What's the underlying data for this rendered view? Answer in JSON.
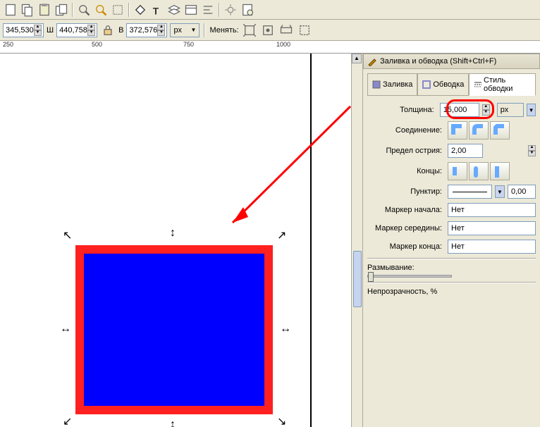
{
  "toolbar2": {
    "coord_value": "345,530",
    "w_label": "Ш",
    "w_value": "440,758",
    "h_label": "В",
    "h_value": "372,576",
    "unit": "px",
    "change_label": "Менять:"
  },
  "ruler": {
    "marks": [
      "250",
      "500",
      "750",
      "1000"
    ]
  },
  "panel": {
    "title": "Заливка и обводка (Shift+Ctrl+F)",
    "tabs": {
      "fill": "Заливка",
      "stroke": "Обводка",
      "style": "Стиль обводки"
    },
    "width_label": "Толщина:",
    "width_value": "15,000",
    "width_unit": "px",
    "join_label": "Соединение:",
    "miter_label": "Предел острия:",
    "miter_value": "2,00",
    "cap_label": "Концы:",
    "dash_label": "Пунктир:",
    "dash_offset": "0,00",
    "marker_start_label": "Маркер начала:",
    "marker_start_value": "Нет",
    "marker_mid_label": "Маркер середины:",
    "marker_mid_value": "Нет",
    "marker_end_label": "Маркер конца:",
    "marker_end_value": "Нет",
    "blur_label": "Размывание:",
    "opacity_label": "Непрозрачность, %"
  }
}
